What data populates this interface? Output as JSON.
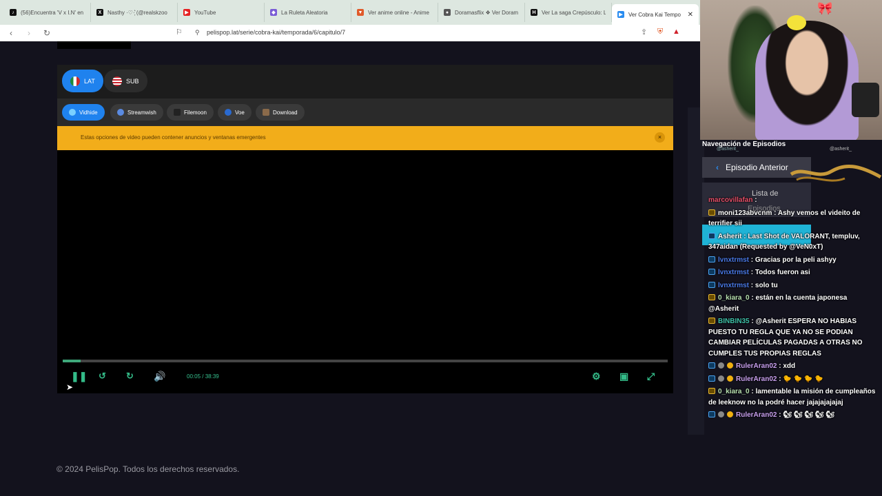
{
  "browser": {
    "tabs": [
      {
        "title": "(56)Encuentra 'V x I.N' en",
        "icon": "tiktok-icon",
        "color": "#111111"
      },
      {
        "title": "Nasthy ·♡·͙͛ (@realskzoo",
        "icon": "x-icon",
        "color": "#111111"
      },
      {
        "title": "YouTube",
        "icon": "youtube-icon",
        "color": "#e52222"
      },
      {
        "title": "La Ruleta Aleatoria",
        "icon": "wheel-icon",
        "color": "#7a5cd6"
      },
      {
        "title": "Ver anime online - Anime",
        "icon": "anime-icon",
        "color": "#e05a2a"
      },
      {
        "title": "Doramasflix ❖ Ver Doram",
        "icon": "globe-icon",
        "color": "#555555"
      },
      {
        "title": "Ver La saga Crepúsculo: L",
        "icon": "hd-icon",
        "color": "#111111"
      },
      {
        "title": "Ver Cobra Kai Tempo",
        "icon": "play-icon",
        "color": "#2a8cf0",
        "active": true
      }
    ],
    "url": "pelispop.lat/serie/cobra-kai/temporada/6/capitulo/7"
  },
  "player": {
    "languages": [
      {
        "label": "LAT",
        "active": true
      },
      {
        "label": "SUB",
        "active": false
      }
    ],
    "servers": [
      {
        "label": "Vidhide",
        "active": true
      },
      {
        "label": "Streamwish",
        "active": false
      },
      {
        "label": "Filemoon",
        "active": false
      },
      {
        "label": "Voe",
        "active": false
      },
      {
        "label": "Download",
        "active": false
      }
    ],
    "warning": "Estas opciones de video pueden contener anuncios y ventanas emergentes",
    "warning_close": "×",
    "time_current": "00:05",
    "time_sep": "/",
    "time_total": "38:39",
    "progress": 0.03
  },
  "footer": {
    "copyright": "© 2024 PelisPop. Todos los derechos reservados."
  },
  "sidebar": {
    "nav_title": "Navegación de Episodios",
    "prev_label": "Episodio Anterior",
    "list_label_1": "Lista de",
    "list_label_2": "Episodios",
    "handle_left": "@asherit_",
    "handle_right": "@asherit_"
  },
  "chat": {
    "messages": [
      {
        "user": "marcovillafan",
        "text": ":",
        "user_color": "#e8506a",
        "badges": []
      },
      {
        "user": "moni123abvcnm",
        "text": ": Ashy vemos el videito de terrifier sii",
        "user_color": "#ffffff",
        "badges": [
          "y"
        ]
      },
      {
        "user": "Asherit",
        "text": ": Last Shot de VALORANT, templuv, 347aidan (Requested by @VeN0xT)",
        "user_color": "#ffffff",
        "badges": [
          "b"
        ]
      },
      {
        "user": "lvnxtrmst",
        "text": ": Gracias por la peli ashyy",
        "user_color": "#4a7ae8",
        "badges": [
          "b"
        ]
      },
      {
        "user": "lvnxtrmst",
        "text": ": Todos fueron asi",
        "user_color": "#4a7ae8",
        "badges": [
          "b"
        ]
      },
      {
        "user": "lvnxtrmst",
        "text": ": solo tu",
        "user_color": "#4a7ae8",
        "badges": [
          "b"
        ]
      },
      {
        "user": "0_kiara_0",
        "text": ": están en la cuenta japonesa @Asherit",
        "user_color": "#b8e0b0",
        "badges": [
          "y"
        ]
      },
      {
        "user": "BINBIN35",
        "text": ": @Asherit ESPERA NO HABIAS PUESTO TU REGLA QUE YA NO SE PODIAN CAMBIAR PELÍCULAS PAGADAS A OTRAS NO CUMPLES TUS PROPIAS REGLAS",
        "user_color": "#3ec0a8",
        "badges": [
          "y"
        ]
      },
      {
        "user": "RulerAran02",
        "text": ": xdd",
        "user_color": "#c9a0f0",
        "badges": [
          "b",
          "g",
          "o"
        ]
      },
      {
        "user": "RulerAran02",
        "text": ": 🐤 🐤 🐤 🐤",
        "user_color": "#c9a0f0",
        "badges": [
          "b",
          "g",
          "o"
        ]
      },
      {
        "user": "0_kiara_0",
        "text": ": lamentable la misión de cumpleaños de leeknow no la podré hacer jajajajajajaj",
        "user_color": "#b8e0b0",
        "badges": [
          "y"
        ]
      },
      {
        "user": "RulerAran02",
        "text": ": 🐿 🐿 🐿 🐿 🐿",
        "user_color": "#c9a0f0",
        "badges": [
          "b",
          "g",
          "o"
        ]
      }
    ]
  }
}
